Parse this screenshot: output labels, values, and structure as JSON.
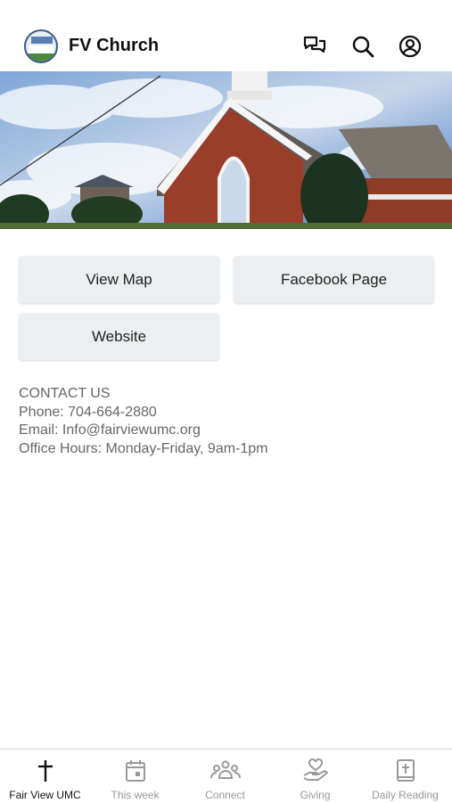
{
  "header": {
    "title": "FV Church",
    "icons": [
      "chat-icon",
      "search-icon",
      "account-icon"
    ]
  },
  "hero": {
    "alt": "church-photo"
  },
  "buttons": {
    "view_map": "View Map",
    "facebook": "Facebook Page",
    "website": "Website"
  },
  "contact": {
    "heading": "CONTACT US",
    "phone": "Phone: 704-664-2880",
    "email": "Email: Info@fairviewumc.org",
    "hours": "Office Hours: Monday-Friday, 9am-1pm"
  },
  "tabs": [
    {
      "label": "Fair View UMC",
      "icon": "cross-icon",
      "active": true
    },
    {
      "label": "This week",
      "icon": "calendar-icon",
      "active": false
    },
    {
      "label": "Connect",
      "icon": "people-icon",
      "active": false
    },
    {
      "label": "Giving",
      "icon": "heart-hand-icon",
      "active": false
    },
    {
      "label": "Daily Reading",
      "icon": "bible-icon",
      "active": false
    }
  ],
  "colors": {
    "button_bg": "#eceef0",
    "tab_inactive": "#999999",
    "text_muted": "#666666"
  }
}
